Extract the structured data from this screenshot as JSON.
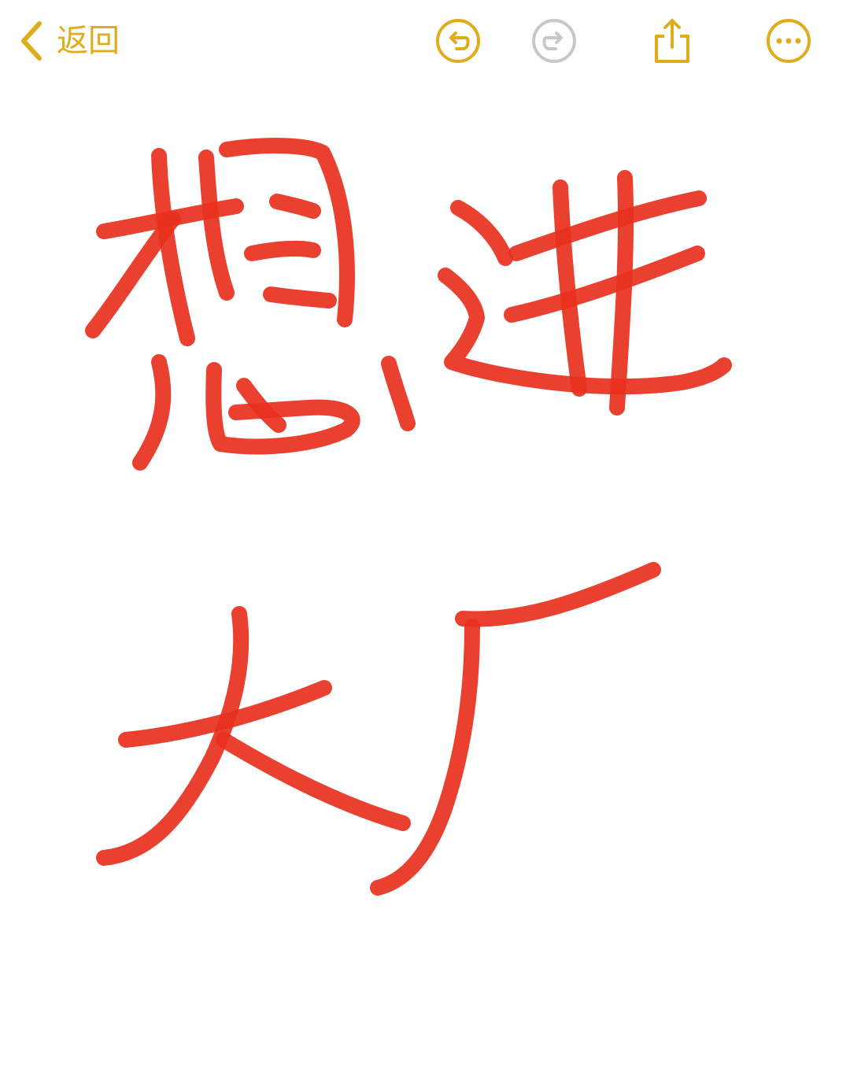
{
  "toolbar": {
    "back_label": "返回",
    "accent_color": "#E0AC1C",
    "disabled_color": "#C7C7CC",
    "buttons": [
      {
        "name": "undo",
        "icon": "undo-icon",
        "enabled": true
      },
      {
        "name": "redo",
        "icon": "redo-icon",
        "enabled": false
      },
      {
        "name": "share",
        "icon": "share-icon",
        "enabled": true
      },
      {
        "name": "more",
        "icon": "more-icon",
        "enabled": true
      }
    ]
  },
  "drawing": {
    "ink_color": "#E8301E",
    "handwritten_lines": [
      "想进",
      "大厂"
    ]
  }
}
